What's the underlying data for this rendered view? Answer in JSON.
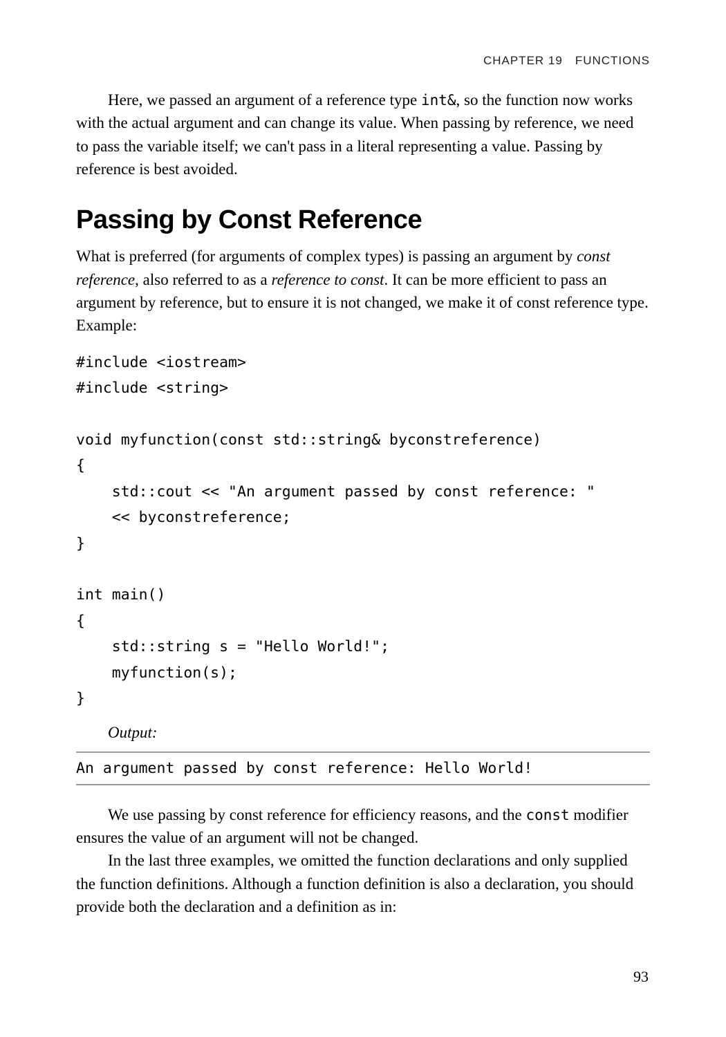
{
  "running_head": {
    "chapter_label": "CHAPTER 19",
    "gap": " ",
    "chapter_title": "FUNCTIONS"
  },
  "para1": {
    "pre": "Here, we passed an argument of a reference type ",
    "code": "int&",
    "post": ", so the function now works with the actual argument and can change its value. When passing by reference, we need to pass the variable itself; we can't pass in a literal representing a value. Passing by reference is best avoided."
  },
  "heading": "Passing by Const Reference",
  "para2": {
    "t1": "What is preferred (for arguments of complex types) is passing an argument by ",
    "i1": "const reference",
    "t2": ", also referred to as a ",
    "i2": "reference to const",
    "t3": ". It can be more efficient to pass an argument by reference, but to ensure it is not changed, we make it of const reference type. Example:"
  },
  "codeblock": "#include <iostream>\n#include <string>\n\nvoid myfunction(const std::string& byconstreference)\n{\n    std::cout << \"An argument passed by const reference: \"\n    << byconstreference;\n}\n\nint main()\n{\n    std::string s = \"Hello World!\";\n    myfunction(s);\n}",
  "output_label": "Output:",
  "output_line": "An argument passed by const reference: Hello World!",
  "para3": {
    "pre": "We use passing by const reference for efficiency reasons, and the ",
    "code": "const",
    "post": " modifier ensures the value of an argument will not be changed."
  },
  "para4": "In the last three examples, we omitted the function declarations and only supplied the function definitions. Although a function definition is also a declaration, you should provide both the declaration and a definition as in:",
  "page_number": "93"
}
